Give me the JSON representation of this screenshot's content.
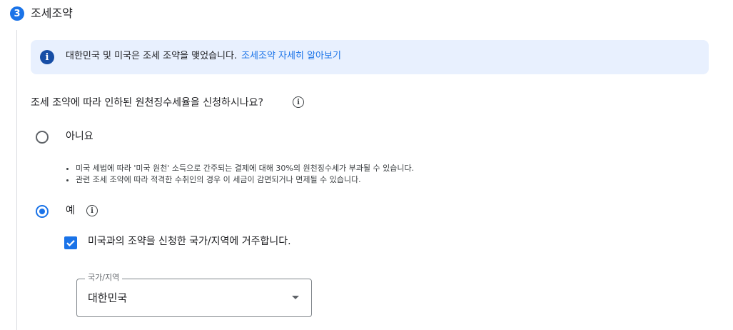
{
  "section": {
    "step_number": "3",
    "title": "조세조약"
  },
  "info_box": {
    "text": "대한민국 및 미국은 조세 조약을 맺었습니다.",
    "link_label": "조세조약 자세히 알아보기"
  },
  "question": {
    "text": "조세 조약에 따라 인하된 원천징수세율을 신청하시나요?"
  },
  "options": {
    "no": {
      "label": "아니요",
      "selected": false,
      "notes": [
        "미국 세법에 따라 '미국 원천' 소득으로 간주되는 결제에 대해 30%의 원천징수세가 부과될 수 있습니다.",
        "관련 조세 조약에 따라 적격한 수취인의 경우 이 세금이 감면되거나 면제될 수 있습니다."
      ]
    },
    "yes": {
      "label": "예",
      "selected": true
    }
  },
  "residency_checkbox": {
    "label": "미국과의 조약을 신청한 국가/지역에 거주합니다.",
    "checked": true
  },
  "country_select": {
    "label": "국가/지역",
    "value": "대한민국"
  },
  "colors": {
    "accent": "#1a73e8",
    "info_background": "#e8f0fe",
    "info_icon": "#174ea6"
  },
  "icons": {
    "info": "info-icon",
    "help": "help-circle-icon",
    "dropdown": "caret-down-icon",
    "check": "check-icon"
  }
}
